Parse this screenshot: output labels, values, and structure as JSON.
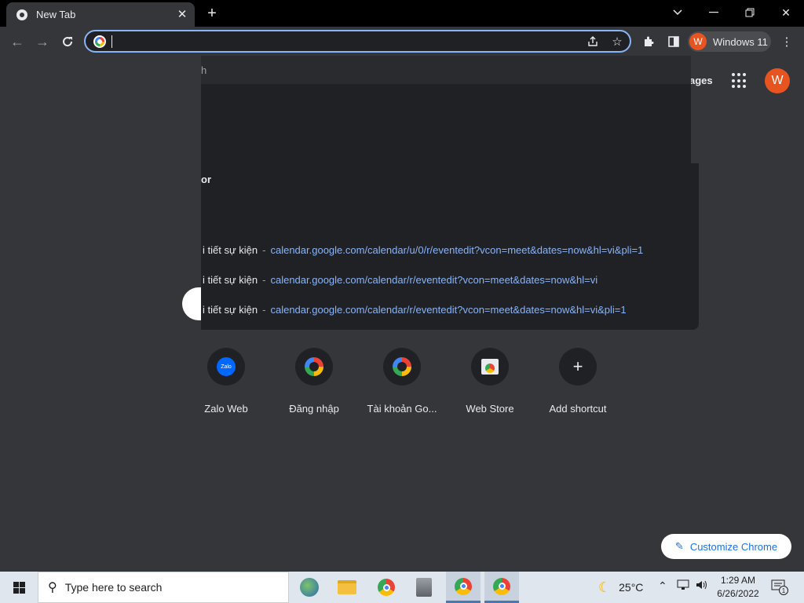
{
  "tab": {
    "title": "New Tab"
  },
  "omnibox": {
    "value": "",
    "placeholder": ""
  },
  "profile": {
    "name": "Windows 11",
    "initial": "W"
  },
  "page": {
    "top_right_link": "ages",
    "avatar_initial": "W",
    "dropdown_top_fragment": "h",
    "section_fragment": "or",
    "suggestions": [
      {
        "title": "i tiết sự kiện",
        "separator": "-",
        "url": "calendar.google.com/calendar/u/0/r/eventedit?vcon=meet&dates=now&hl=vi&pli=1"
      },
      {
        "title": "i tiết sự kiện",
        "separator": "-",
        "url": "calendar.google.com/calendar/r/eventedit?vcon=meet&dates=now&hl=vi"
      },
      {
        "title": "i tiết sự kiện",
        "separator": "-",
        "url": "calendar.google.com/calendar/r/eventedit?vcon=meet&dates=now&hl=vi&pli=1"
      }
    ],
    "shortcuts": [
      {
        "label": "Zalo Web",
        "icon": "zalo-icon"
      },
      {
        "label": "Đăng nhập",
        "icon": "google-icon"
      },
      {
        "label": "Tài khoản Go...",
        "icon": "google-icon"
      },
      {
        "label": "Web Store",
        "icon": "web-store-icon"
      },
      {
        "label": "Add shortcut",
        "icon": "plus-icon"
      }
    ],
    "customize_label": "Customize Chrome"
  },
  "taskbar": {
    "search_placeholder": "Type here to search",
    "weather": "25°C",
    "time": "1:29 AM",
    "date": "6/26/2022",
    "notification_count": "1"
  }
}
